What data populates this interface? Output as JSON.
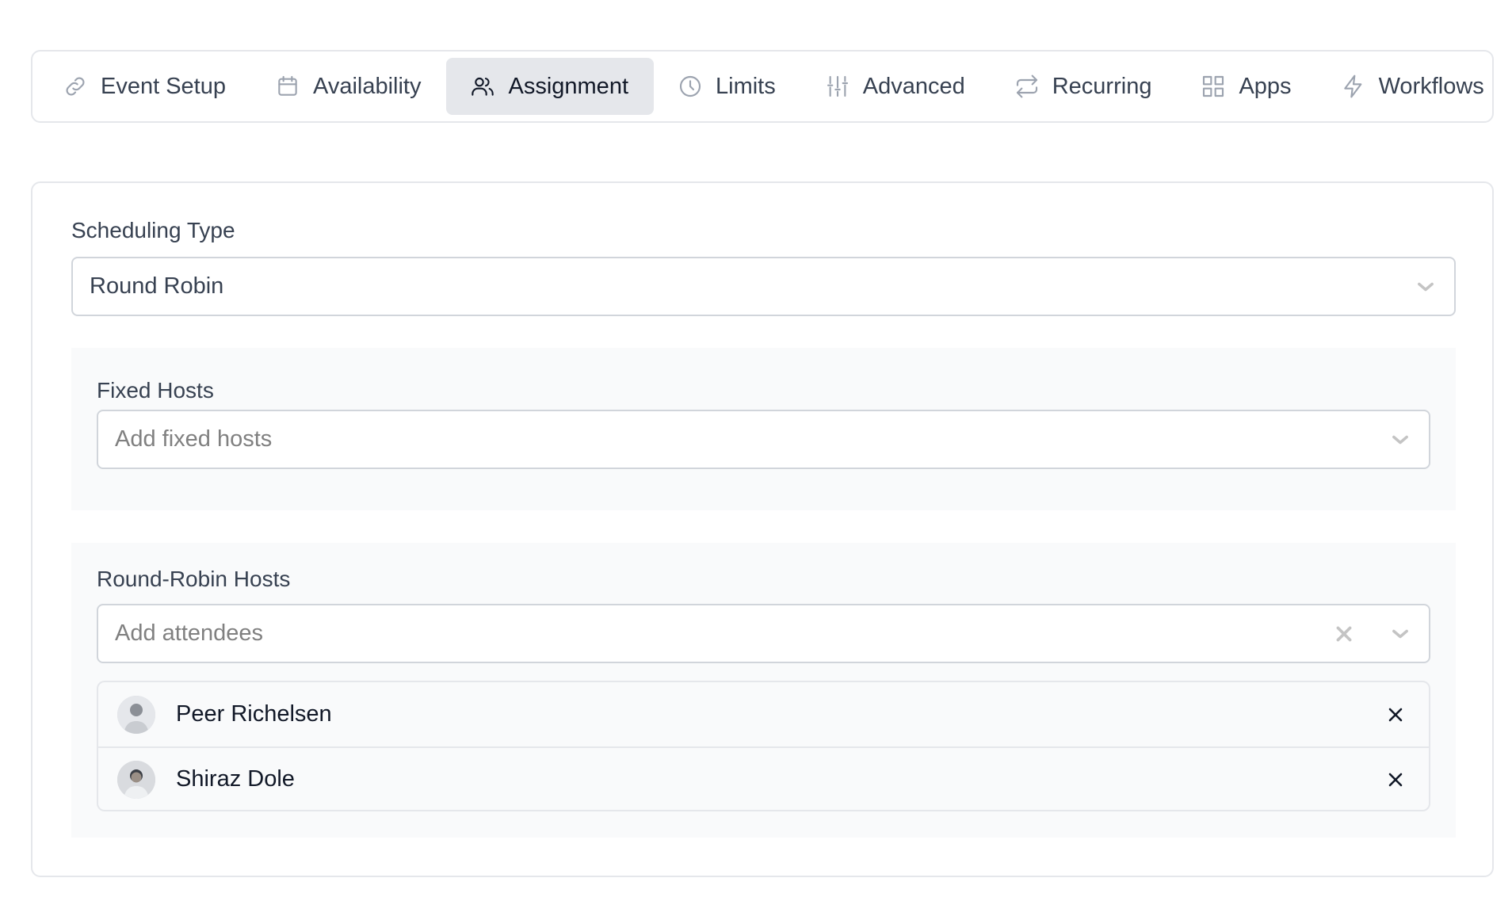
{
  "tabs": [
    {
      "label": "Event Setup",
      "icon": "link-icon",
      "active": false
    },
    {
      "label": "Availability",
      "icon": "calendar-icon",
      "active": false
    },
    {
      "label": "Assignment",
      "icon": "users-icon",
      "active": true
    },
    {
      "label": "Limits",
      "icon": "clock-icon",
      "active": false
    },
    {
      "label": "Advanced",
      "icon": "sliders-icon",
      "active": false
    },
    {
      "label": "Recurring",
      "icon": "repeat-icon",
      "active": false
    },
    {
      "label": "Apps",
      "icon": "grid-icon",
      "active": false
    },
    {
      "label": "Workflows",
      "icon": "zap-icon",
      "active": false
    }
  ],
  "scheduling": {
    "label": "Scheduling Type",
    "value": "Round Robin"
  },
  "fixed_hosts": {
    "label": "Fixed Hosts",
    "placeholder": "Add fixed hosts"
  },
  "round_robin_hosts": {
    "label": "Round-Robin Hosts",
    "placeholder": "Add attendees",
    "hosts": [
      {
        "name": "Peer Richelsen"
      },
      {
        "name": "Shiraz Dole"
      }
    ]
  }
}
